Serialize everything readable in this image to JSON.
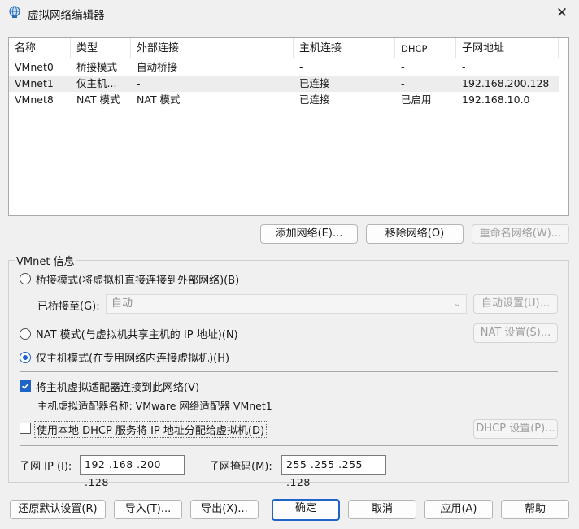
{
  "window": {
    "title": "虚拟网络编辑器",
    "close": "✕"
  },
  "table": {
    "columns": [
      "名称",
      "类型",
      "外部连接",
      "主机连接",
      "DHCP",
      "子网地址"
    ],
    "rows": [
      [
        "VMnet0",
        "桥接模式",
        "自动桥接",
        "-",
        "-",
        "-"
      ],
      [
        "VMnet1",
        "仅主机...",
        "-",
        "已连接",
        "-",
        "192.168.200.128"
      ],
      [
        "VMnet8",
        "NAT 模式",
        "NAT 模式",
        "已连接",
        "已启用",
        "192.168.10.0"
      ]
    ],
    "selected_row": 1
  },
  "network_buttons": {
    "add": "添加网络(E)...",
    "remove": "移除网络(O)",
    "rename": "重命名网络(W)..."
  },
  "vmnet_info": {
    "group_title": "VMnet 信息",
    "bridged_radio": "桥接模式(将虚拟机直接连接到外部网络)(B)",
    "bridged_to_label": "已桥接至(G):",
    "bridged_to_value": "自动",
    "auto_settings": "自动设置(U)...",
    "nat_radio": "NAT 模式(与虚拟机共享主机的 IP 地址)(N)",
    "nat_settings": "NAT 设置(S)...",
    "host_only_radio": "仅主机模式(在专用网络内连接虚拟机)(H)",
    "selected_mode": "host_only",
    "connect_adapter_check": "将主机虚拟适配器连接到此网络(V)",
    "connect_adapter_checked": true,
    "adapter_name": "主机虚拟适配器名称: VMware 网络适配器 VMnet1",
    "dhcp_check": "使用本地 DHCP 服务将 IP 地址分配给虚拟机(D)",
    "dhcp_checked": false,
    "dhcp_settings": "DHCP 设置(P)...",
    "subnet_ip_label": "子网 IP (I):",
    "subnet_ip": "192 .168 .200 .128",
    "subnet_mask_label": "子网掩码(M):",
    "subnet_mask": "255 .255 .255 .128"
  },
  "footer": {
    "restore": "还原默认设置(R)",
    "import": "导入(T)...",
    "export": "导出(X)...",
    "ok": "确定",
    "cancel": "取消",
    "apply": "应用(A)",
    "help": "帮助"
  },
  "colors": {
    "accent": "#1e64c8",
    "selected_row": "#ededed"
  },
  "icons": {
    "app": "network-globe-icon",
    "close": "close-icon"
  }
}
